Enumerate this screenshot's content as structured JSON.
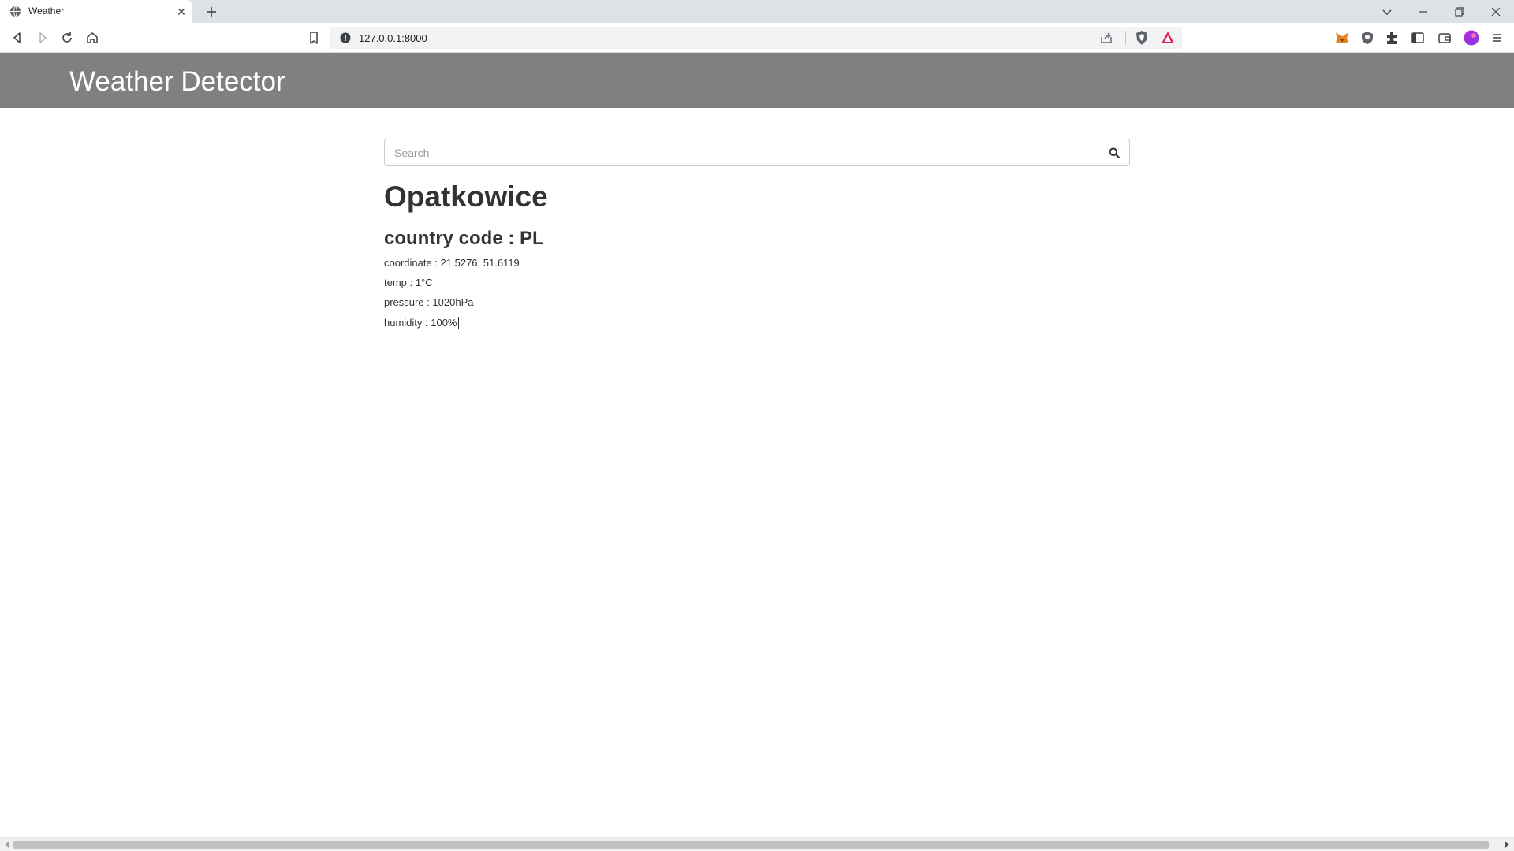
{
  "browser": {
    "tab": {
      "title": "Weather",
      "close_glyph": "✕"
    },
    "address": {
      "url": "127.0.0.1:8000"
    }
  },
  "page": {
    "brand": "Weather Detector",
    "search": {
      "placeholder": "Search",
      "value": ""
    },
    "city": "Opatkowice",
    "country_line": "country code : PL",
    "details": [
      "coordinate : 21.5276, 51.6119",
      "temp : 1°C",
      "pressure : 1020hPa",
      "humidity : 100%"
    ]
  },
  "colors": {
    "navbar": "#808080",
    "tabstrip": "#dee1e6",
    "text": "#333333"
  }
}
